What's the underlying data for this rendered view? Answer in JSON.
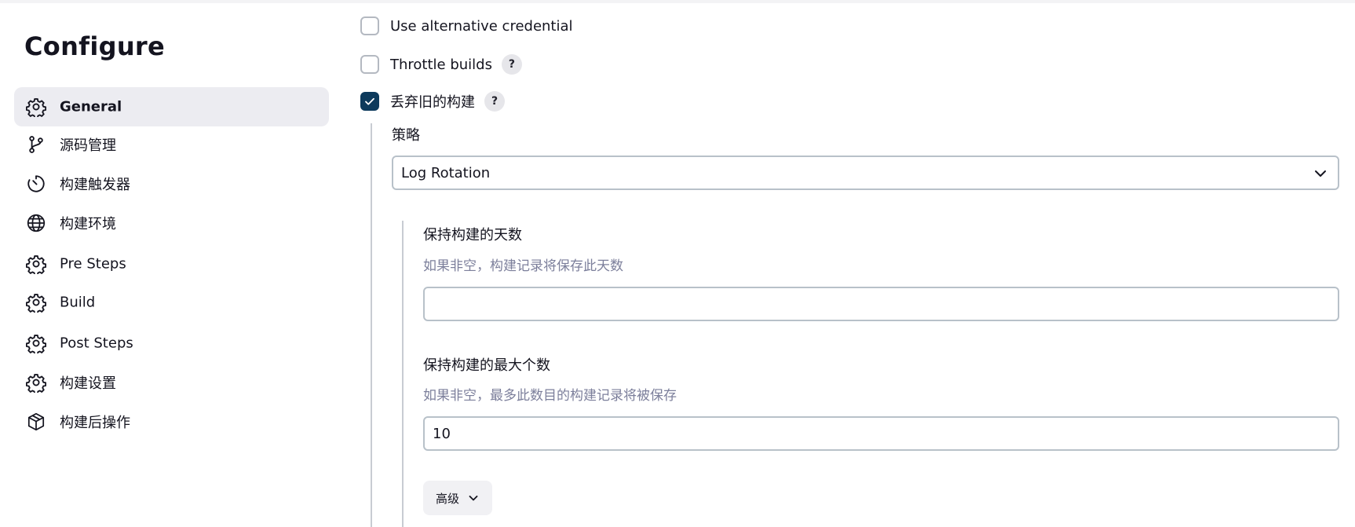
{
  "page": {
    "title": "Configure"
  },
  "sidebar": {
    "items": [
      {
        "label": "General",
        "icon": "gear-icon",
        "active": true
      },
      {
        "label": "源码管理",
        "icon": "git-branch-icon",
        "active": false
      },
      {
        "label": "构建触发器",
        "icon": "timer-icon",
        "active": false
      },
      {
        "label": "构建环境",
        "icon": "globe-icon",
        "active": false
      },
      {
        "label": "Pre Steps",
        "icon": "gear-icon",
        "active": false
      },
      {
        "label": "Build",
        "icon": "gear-icon",
        "active": false
      },
      {
        "label": "Post Steps",
        "icon": "gear-icon",
        "active": false
      },
      {
        "label": "构建设置",
        "icon": "gear-icon",
        "active": false
      },
      {
        "label": "构建后操作",
        "icon": "package-icon",
        "active": false
      }
    ]
  },
  "options": {
    "alt_credential": {
      "label": "Use alternative credential",
      "checked": false
    },
    "throttle_builds": {
      "label": "Throttle builds",
      "checked": false,
      "help": "?"
    },
    "discard_old_builds": {
      "label": "丢弃旧的构建",
      "checked": true,
      "help": "?"
    }
  },
  "strategy": {
    "label": "策略",
    "selected": "Log Rotation",
    "days_to_keep": {
      "label": "保持构建的天数",
      "description": "如果非空，构建记录将保存此天数",
      "value": ""
    },
    "max_builds": {
      "label": "保持构建的最大个数",
      "description": "如果非空，最多此数目的构建记录将被保存",
      "value": "10"
    },
    "advanced_label": "高级"
  },
  "colors": {
    "accent": "#0d3a5c",
    "active_nav_bg": "#ececf1",
    "description_text": "#7c7f9b",
    "border": "#b8c1c9"
  }
}
